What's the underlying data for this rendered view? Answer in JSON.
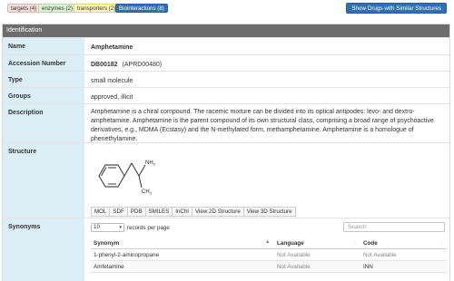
{
  "tags": {
    "targets": "targets (4)",
    "enzymes": "enzymes (2)",
    "transporters": "transporters (2)",
    "biointeractions": "Biointeractions (8)"
  },
  "colors": {
    "accent": "#2f6fb3",
    "label_bg": "#dbeef6",
    "header_bg": "#6d6d6d"
  },
  "show_button": "Show Drugs with Similar Structures",
  "section": {
    "title": "Identification"
  },
  "fields": {
    "name_label": "Name",
    "name_value": "Amphetamine",
    "accession_label": "Accession Number",
    "accession_primary": "DB00182",
    "accession_secondary": "(APRD00480)",
    "type_label": "Type",
    "type_value": "small molecule",
    "groups_label": "Groups",
    "groups_value": "approved, illicit",
    "description_label": "Description",
    "description_value": "Amphetamine is a chiral compound. The racemic mixture can be divided into its optical antipodes: levo- and dextro-amphetamine. Amphetamine is the parent compound of its own structural class, comprising a broad range of psychoactive derivatives, e.g., MDMA (Ecstasy) and the N-methylated form, methamphetamine. Amphetamine is a homologue of phenethylamine.",
    "structure_label": "Structure",
    "synonyms_label": "Synonyms"
  },
  "structure": {
    "atom_nh2": "NH",
    "atom_nh2_sub": "2",
    "atom_ch3": "CH",
    "atom_ch3_sub": "3",
    "buttons": [
      "MOL",
      "SDF",
      "PDB",
      "SMILES",
      "InChI",
      "View 2D Structure",
      "View 3D Structure"
    ]
  },
  "synonyms": {
    "page_size": "10",
    "per_page_label": "records per page",
    "search_placeholder": "Search",
    "columns": [
      "Synonym",
      "Language",
      "Code"
    ],
    "rows": [
      [
        "1-phenyl-2-aminopropane",
        "Not Available",
        "Not Available"
      ],
      [
        "Amfetamine",
        "Not Available",
        "INN"
      ]
    ]
  }
}
